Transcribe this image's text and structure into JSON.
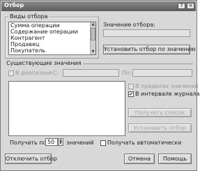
{
  "window": {
    "title": "Отбор",
    "help_glyph": "?",
    "close_glyph": "×"
  },
  "filter_types": {
    "group_label": "Виды отбора",
    "items": [
      "Сумма операции",
      "Содержание операции",
      "Контрагент",
      "Продавец",
      "Покупатель"
    ]
  },
  "filter_value": {
    "label": "Значение отбора:",
    "apply_button": "Установить отбор по значению"
  },
  "existing": {
    "group_label": "Существующие значения",
    "range_checkbox": "В диапазоне",
    "from_label": "С:",
    "to_label": "По:",
    "in_period_checkbox": "В пределах значений",
    "in_journal_interval_checkbox": "В интервале журнала",
    "in_journal_interval_checked": true,
    "get_list_button": "Получить список",
    "set_filter_button": "Установить отбор"
  },
  "fetch": {
    "label_prefix": "Получать по:",
    "count": "50",
    "label_suffix": "значений",
    "auto_checkbox": "Получать автоматически"
  },
  "footer": {
    "disable_button": "Отключить отбор",
    "cancel_button": "Отмена",
    "help_button": "Помощь"
  }
}
